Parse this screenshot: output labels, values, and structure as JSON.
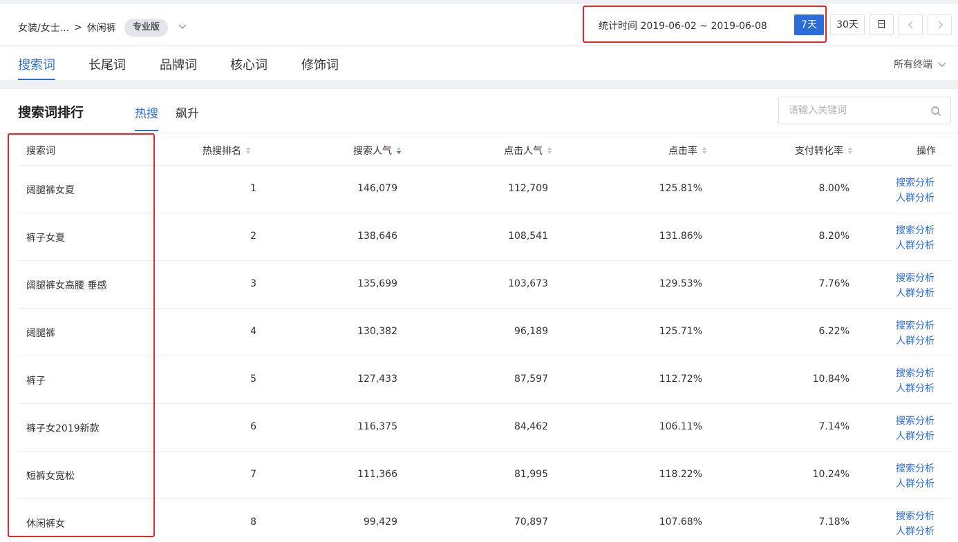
{
  "header": {
    "breadcrumb_parent": "女装/女士...",
    "breadcrumb_sep": ">",
    "breadcrumb_current": "休闲裤",
    "edition_badge": "专业版",
    "date_label": "统计时间 2019-06-02 ~ 2019-06-08",
    "btn_7d": "7天",
    "btn_30d": "30天",
    "btn_day": "日"
  },
  "tabs": [
    {
      "label": "搜索词",
      "active": true
    },
    {
      "label": "长尾词"
    },
    {
      "label": "品牌词"
    },
    {
      "label": "核心词"
    },
    {
      "label": "修饰词"
    }
  ],
  "terminal_label": "所有终端",
  "panel": {
    "title": "搜索词排行",
    "subtab_hot": "热搜",
    "subtab_rise": "飙升",
    "search_placeholder": "请输入关键词"
  },
  "table": {
    "columns": [
      "搜索词",
      "热搜排名",
      "搜索人气",
      "点击人气",
      "点击率",
      "支付转化率",
      "操作"
    ],
    "op_search": "搜索分析",
    "op_crowd": "人群分析",
    "rows": [
      {
        "keyword": "阔腿裤女夏",
        "rank": "1",
        "search_pop": "146,079",
        "click_pop": "112,709",
        "ctr": "125.81%",
        "cvr": "8.00%"
      },
      {
        "keyword": "裤子女夏",
        "rank": "2",
        "search_pop": "138,646",
        "click_pop": "108,541",
        "ctr": "131.86%",
        "cvr": "8.20%"
      },
      {
        "keyword": "阔腿裤女高腰 垂感",
        "rank": "3",
        "search_pop": "135,699",
        "click_pop": "103,673",
        "ctr": "129.53%",
        "cvr": "7.76%"
      },
      {
        "keyword": "阔腿裤",
        "rank": "4",
        "search_pop": "130,382",
        "click_pop": "96,189",
        "ctr": "125.71%",
        "cvr": "6.22%"
      },
      {
        "keyword": "裤子",
        "rank": "5",
        "search_pop": "127,433",
        "click_pop": "87,597",
        "ctr": "112.72%",
        "cvr": "10.84%"
      },
      {
        "keyword": "裤子女2019新款",
        "rank": "6",
        "search_pop": "116,375",
        "click_pop": "84,462",
        "ctr": "106.11%",
        "cvr": "7.14%"
      },
      {
        "keyword": "短裤女宽松",
        "rank": "7",
        "search_pop": "111,366",
        "click_pop": "81,995",
        "ctr": "118.22%",
        "cvr": "10.24%"
      },
      {
        "keyword": "休闲裤女",
        "rank": "8",
        "search_pop": "99,429",
        "click_pop": "70,897",
        "ctr": "107.68%",
        "cvr": "7.18%"
      }
    ]
  },
  "colors": {
    "accent": "#2b6cdb",
    "highlight_box": "#e8262a"
  }
}
